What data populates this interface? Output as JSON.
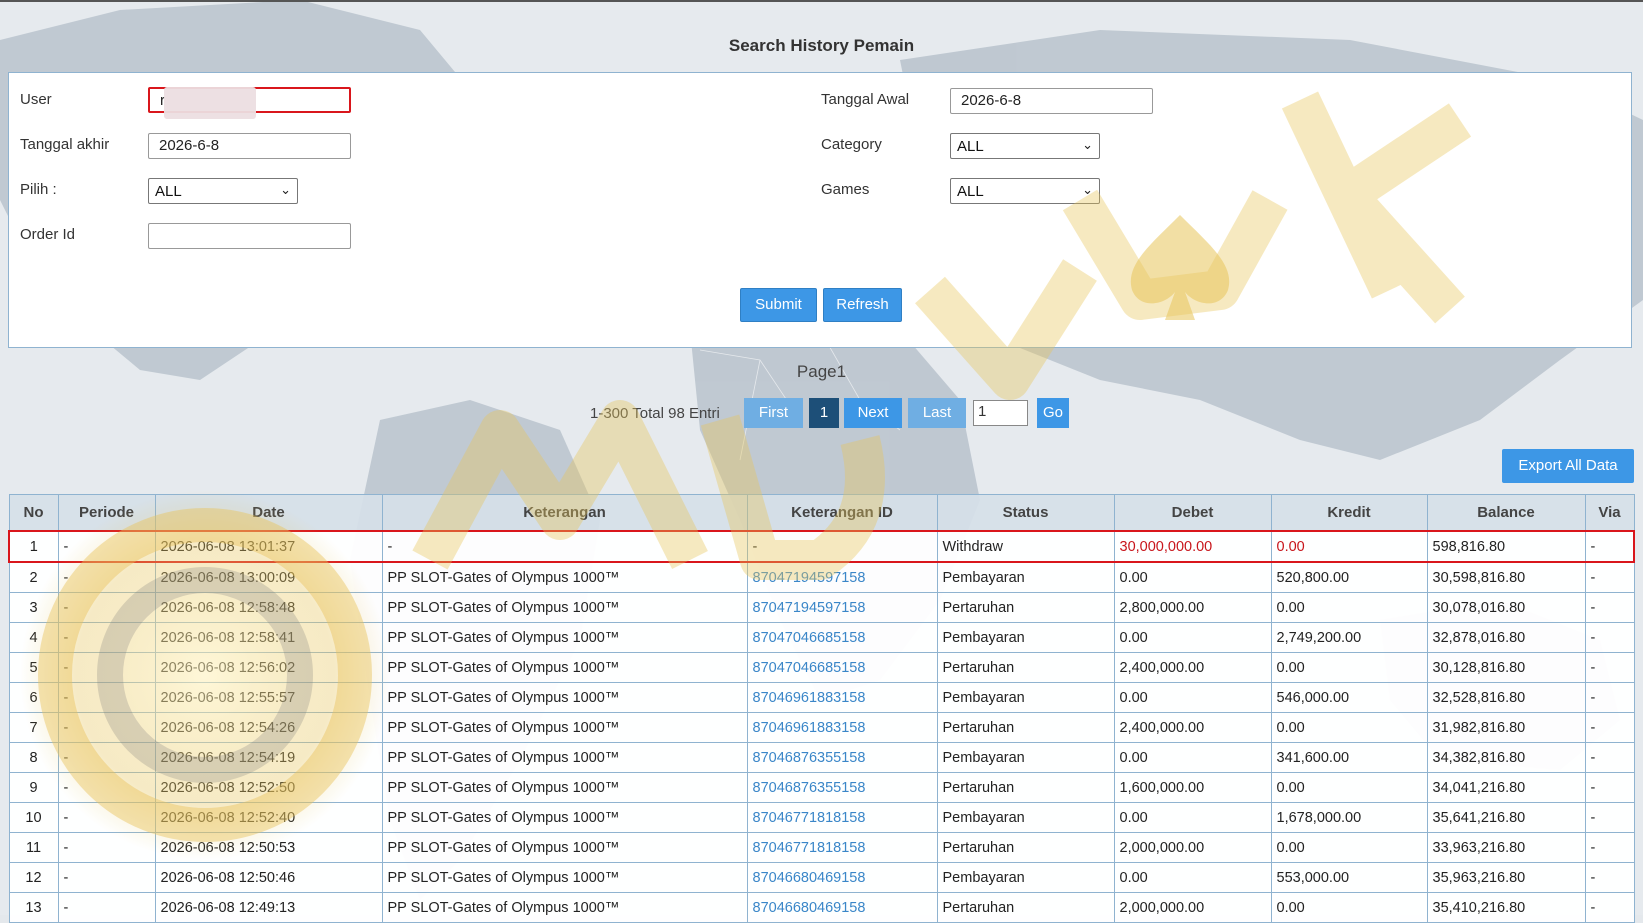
{
  "page_title": "Search History Pemain",
  "form": {
    "user_label": "User",
    "user_value": "r",
    "tanggal_akhir_label": "Tanggal akhir",
    "tanggal_akhir_value": "2026-6-8",
    "pilih_label": "Pilih  :",
    "pilih_value": "ALL",
    "order_id_label": "Order Id",
    "order_id_value": "",
    "tanggal_awal_label": "Tanggal Awal",
    "tanggal_awal_value": "2026-6-8",
    "category_label": "Category",
    "category_value": "ALL",
    "games_label": "Games",
    "games_value": "ALL",
    "submit_label": "Submit",
    "refresh_label": "Refresh"
  },
  "pagination": {
    "page_label": "Page1",
    "info": "1-300 Total 98 Entri",
    "first": "First",
    "current": "1",
    "next": "Next",
    "last": "Last",
    "page_input_value": "1",
    "go": "Go"
  },
  "export_label": "Export All Data",
  "table": {
    "headers": [
      "No",
      "Periode",
      "Date",
      "Keterangan",
      "Keterangan ID",
      "Status",
      "Debet",
      "Kredit",
      "Balance",
      "Via"
    ],
    "rows": [
      {
        "no": "1",
        "periode": "-",
        "date": "2026-06-08 13:01:37",
        "ket": "-",
        "ket_id": "-",
        "status": "Withdraw",
        "debet": "30,000,000.00",
        "kredit": "0.00",
        "balance": "598,816.80",
        "via": "-"
      },
      {
        "no": "2",
        "periode": "-",
        "date": "2026-06-08 13:00:09",
        "ket": "PP SLOT-Gates of Olympus 1000™",
        "ket_id": "87047194597158",
        "status": "Pembayaran",
        "debet": "0.00",
        "kredit": "520,800.00",
        "balance": "30,598,816.80",
        "via": "-"
      },
      {
        "no": "3",
        "periode": "-",
        "date": "2026-06-08 12:58:48",
        "ket": "PP SLOT-Gates of Olympus 1000™",
        "ket_id": "87047194597158",
        "status": "Pertaruhan",
        "debet": "2,800,000.00",
        "kredit": "0.00",
        "balance": "30,078,016.80",
        "via": "-"
      },
      {
        "no": "4",
        "periode": "-",
        "date": "2026-06-08 12:58:41",
        "ket": "PP SLOT-Gates of Olympus 1000™",
        "ket_id": "87047046685158",
        "status": "Pembayaran",
        "debet": "0.00",
        "kredit": "2,749,200.00",
        "balance": "32,878,016.80",
        "via": "-"
      },
      {
        "no": "5",
        "periode": "-",
        "date": "2026-06-08 12:56:02",
        "ket": "PP SLOT-Gates of Olympus 1000™",
        "ket_id": "87047046685158",
        "status": "Pertaruhan",
        "debet": "2,400,000.00",
        "kredit": "0.00",
        "balance": "30,128,816.80",
        "via": "-"
      },
      {
        "no": "6",
        "periode": "-",
        "date": "2026-06-08 12:55:57",
        "ket": "PP SLOT-Gates of Olympus 1000™",
        "ket_id": "87046961883158",
        "status": "Pembayaran",
        "debet": "0.00",
        "kredit": "546,000.00",
        "balance": "32,528,816.80",
        "via": "-"
      },
      {
        "no": "7",
        "periode": "-",
        "date": "2026-06-08 12:54:26",
        "ket": "PP SLOT-Gates of Olympus 1000™",
        "ket_id": "87046961883158",
        "status": "Pertaruhan",
        "debet": "2,400,000.00",
        "kredit": "0.00",
        "balance": "31,982,816.80",
        "via": "-"
      },
      {
        "no": "8",
        "periode": "-",
        "date": "2026-06-08 12:54:19",
        "ket": "PP SLOT-Gates of Olympus 1000™",
        "ket_id": "87046876355158",
        "status": "Pembayaran",
        "debet": "0.00",
        "kredit": "341,600.00",
        "balance": "34,382,816.80",
        "via": "-"
      },
      {
        "no": "9",
        "periode": "-",
        "date": "2026-06-08 12:52:50",
        "ket": "PP SLOT-Gates of Olympus 1000™",
        "ket_id": "87046876355158",
        "status": "Pertaruhan",
        "debet": "1,600,000.00",
        "kredit": "0.00",
        "balance": "34,041,216.80",
        "via": "-"
      },
      {
        "no": "10",
        "periode": "-",
        "date": "2026-06-08 12:52:40",
        "ket": "PP SLOT-Gates of Olympus 1000™",
        "ket_id": "87046771818158",
        "status": "Pembayaran",
        "debet": "0.00",
        "kredit": "1,678,000.00",
        "balance": "35,641,216.80",
        "via": "-"
      },
      {
        "no": "11",
        "periode": "-",
        "date": "2026-06-08 12:50:53",
        "ket": "PP SLOT-Gates of Olympus 1000™",
        "ket_id": "87046771818158",
        "status": "Pertaruhan",
        "debet": "2,000,000.00",
        "kredit": "0.00",
        "balance": "33,963,216.80",
        "via": "-"
      },
      {
        "no": "12",
        "periode": "-",
        "date": "2026-06-08 12:50:46",
        "ket": "PP SLOT-Gates of Olympus 1000™",
        "ket_id": "87046680469158",
        "status": "Pembayaran",
        "debet": "0.00",
        "kredit": "553,000.00",
        "balance": "35,963,216.80",
        "via": "-"
      },
      {
        "no": "13",
        "periode": "-",
        "date": "2026-06-08 12:49:13",
        "ket": "PP SLOT-Gates of Olympus 1000™",
        "ket_id": "87046680469158",
        "status": "Pertaruhan",
        "debet": "2,000,000.00",
        "kredit": "0.00",
        "balance": "35,410,216.80",
        "via": "-"
      }
    ]
  },
  "colors": {
    "accent": "#3d97e6",
    "highlight": "#d9161c",
    "link": "#3a86c8",
    "watermark_gold": "#e8c45a"
  },
  "watermark_icon": "spade-icon"
}
